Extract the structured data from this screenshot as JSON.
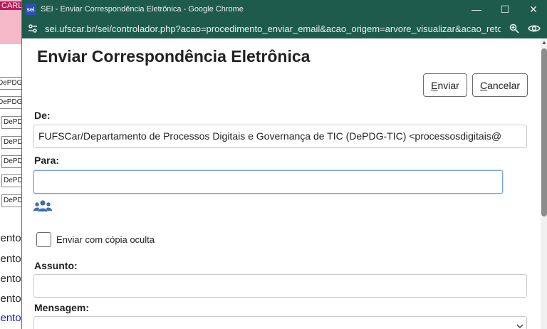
{
  "background": {
    "top_text": "CARLO",
    "buttons": [
      "DePDG",
      "DePDG",
      "DePDG",
      "DePDG",
      "DePDG",
      "DePDG",
      "DePDG"
    ],
    "lines": [
      "mento",
      "mento",
      "mento",
      "mento",
      "mento"
    ]
  },
  "window": {
    "app_icon": "sei",
    "title": "SEI - Enviar Correspondência Eletrônica - Google Chrome",
    "minimize": "—",
    "maximize": "☐",
    "close": "✕"
  },
  "address_bar": {
    "url": "sei.ufscar.br/sei/controlador.php?acao=procedimento_enviar_email&acao_origem=arvore_visualizar&acao_retorno=arvo..."
  },
  "form": {
    "title": "Enviar Correspondência Eletrônica",
    "send_button": {
      "mnemonic": "E",
      "rest": "nviar"
    },
    "cancel_button": {
      "mnemonic": "C",
      "rest": "ancelar"
    },
    "from_label": "De:",
    "from_value": "FUFSCar/Departamento de Processos Digitais e Governança de TIC (DePDG-TIC) <processosdigitais@",
    "to_label": "Para:",
    "to_value": "",
    "bcc_label": "Enviar com cópia oculta",
    "subject_label": "Assunto:",
    "subject_value": "",
    "message_label": "Mensagem:"
  },
  "colors": {
    "chrome_frame": "#1f5b4c",
    "focus_border": "#7aa3d8",
    "group_icon": "#3c6fb0"
  }
}
